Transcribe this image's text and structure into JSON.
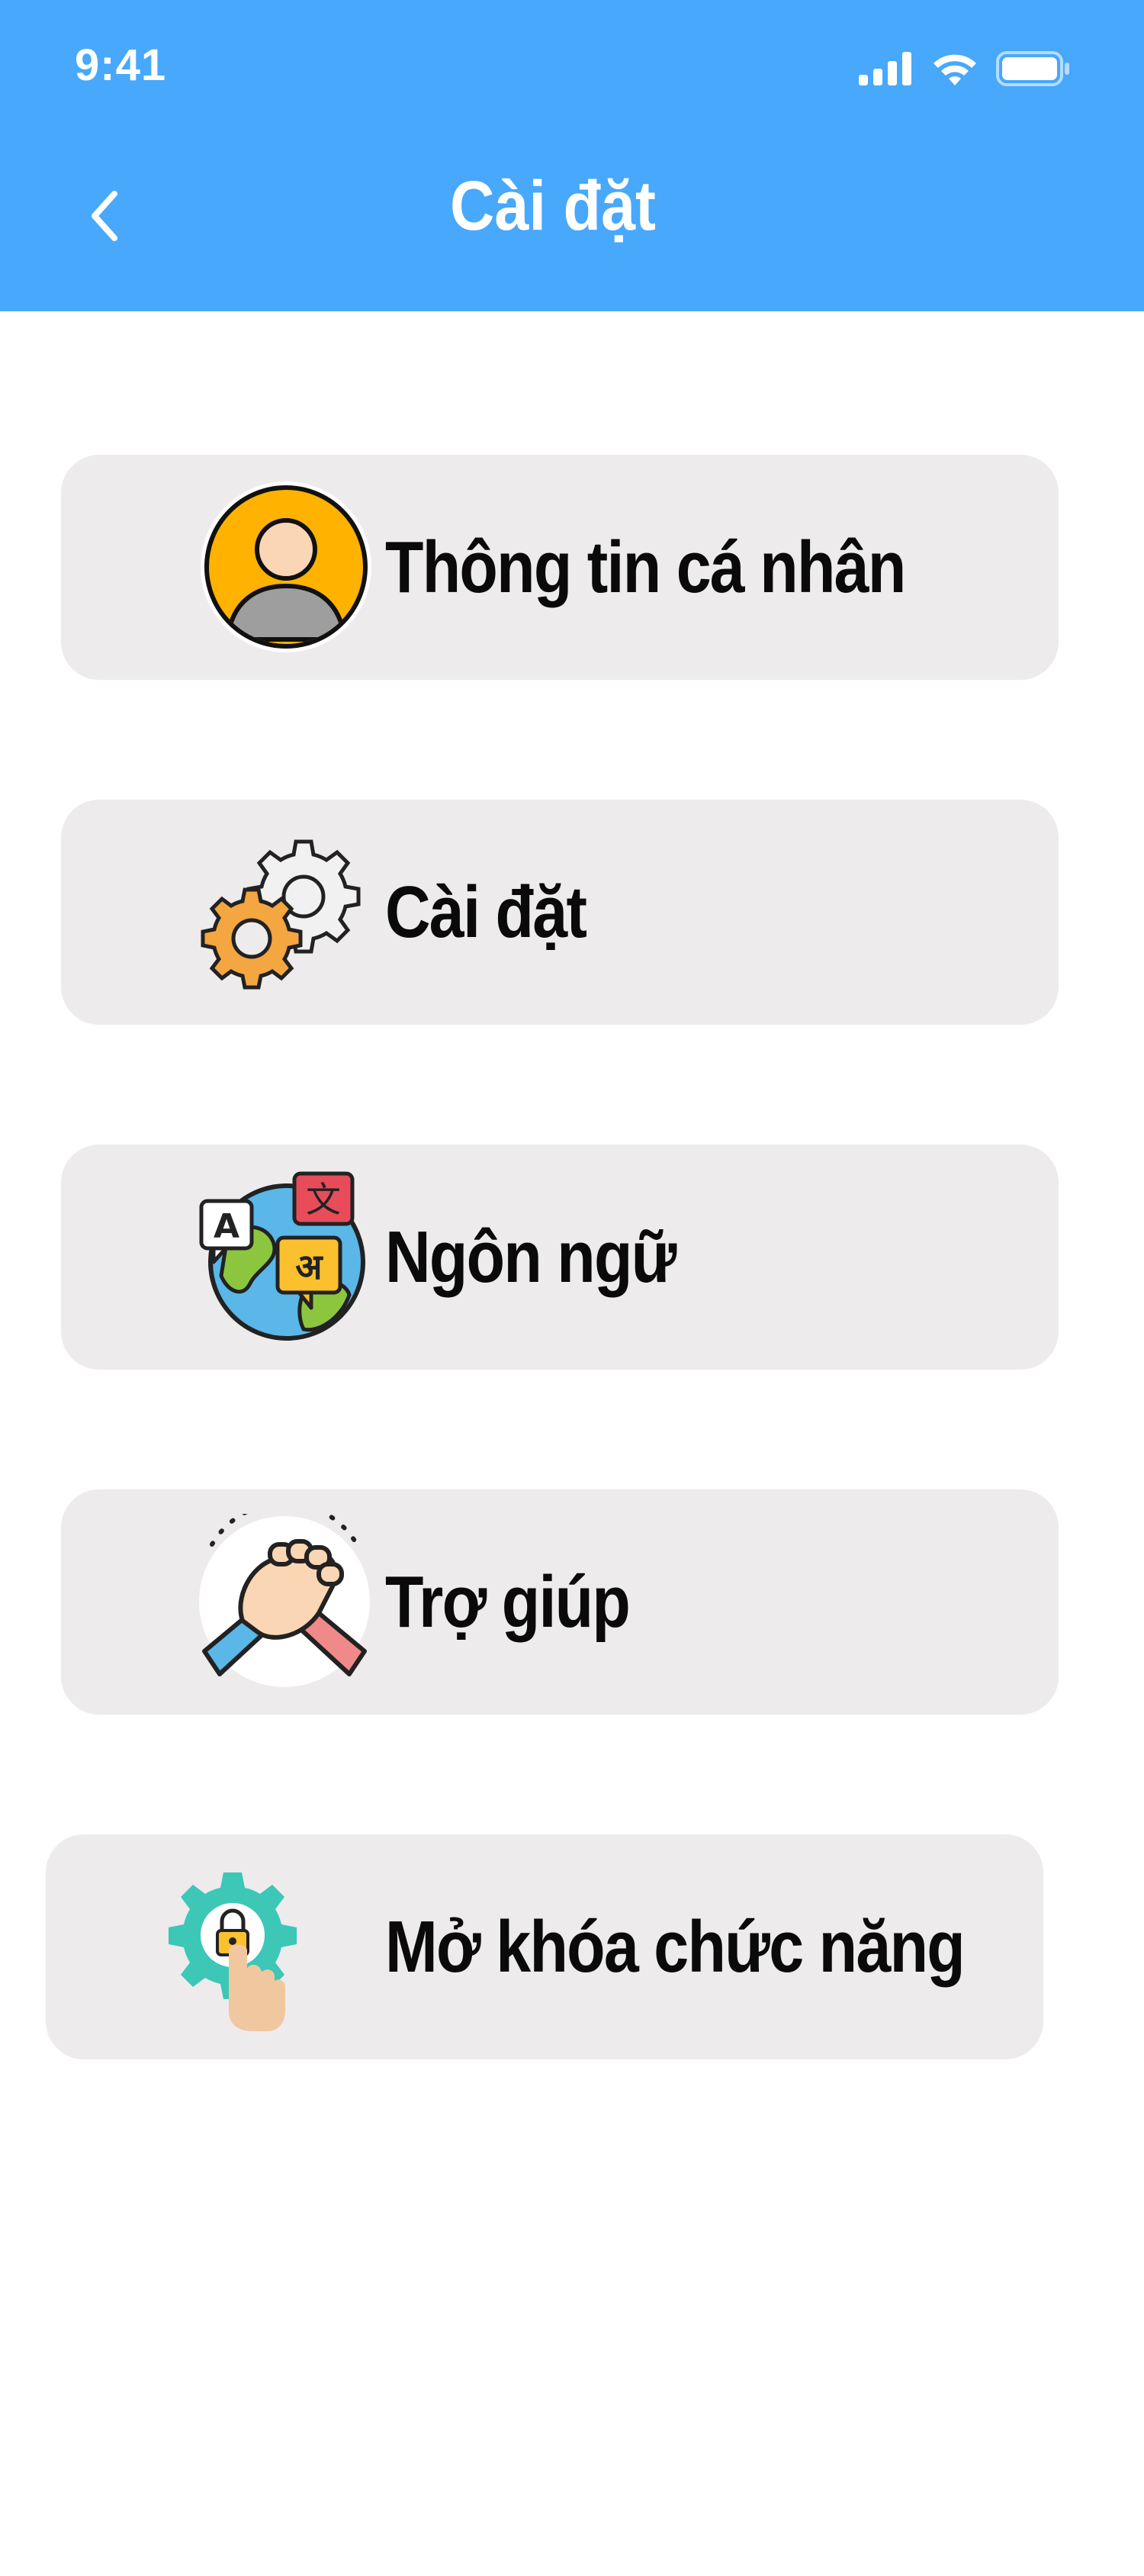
{
  "status_bar": {
    "time": "9:41",
    "icons": [
      "signal-icon",
      "wifi-icon",
      "battery-icon"
    ]
  },
  "header": {
    "title": "Cài đặt",
    "back_icon": "chevron-left-icon",
    "background_color": "#47a8fc"
  },
  "menu": {
    "items": [
      {
        "label": "Thông tin cá nhân",
        "icon": "user-profile-icon"
      },
      {
        "label": "Cài đặt",
        "icon": "gears-icon"
      },
      {
        "label": "Ngôn ngữ",
        "icon": "language-globe-icon"
      },
      {
        "label": "Trợ giúp",
        "icon": "handshake-help-icon"
      },
      {
        "label": "Mở khóa chức năng",
        "icon": "unlock-feature-icon"
      }
    ],
    "card_color": "#edebec"
  }
}
